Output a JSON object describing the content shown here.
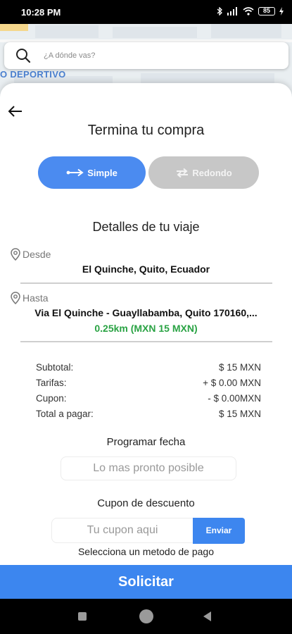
{
  "status_bar": {
    "time": "10:28 PM",
    "battery": "85",
    "icons": [
      "bluetooth-icon",
      "signal-icon",
      "wifi-icon",
      "battery-icon"
    ]
  },
  "map": {
    "label": "O DEPORTIVO"
  },
  "search": {
    "placeholder": "¿A dónde vas?"
  },
  "checkout": {
    "title": "Termina tu compra",
    "trip_types": [
      {
        "label": "Simple",
        "icon": "one-way-arrow-icon",
        "active": true
      },
      {
        "label": "Redondo",
        "icon": "round-trip-icon",
        "active": false
      }
    ],
    "details_title": "Detalles de tu viaje",
    "from_label": "Desde",
    "from_value": "El Quinche, Quito, Ecuador",
    "to_label": "Hasta",
    "to_value": "Via El Quinche - Guayllabamba, Quito 170160,...",
    "distance": "0.25km (MXN 15 MXN)",
    "summary": [
      {
        "label": "Subtotal:",
        "value": "$ 15 MXN"
      },
      {
        "label": "Tarifas:",
        "value": "+ $ 0.00 MXN"
      },
      {
        "label": "Cupon:",
        "value": "- $ 0.00MXN"
      },
      {
        "label": "Total a pagar:",
        "value": "$ 15 MXN"
      }
    ],
    "schedule_label": "Programar fecha",
    "schedule_value": "Lo mas pronto posible",
    "coupon_label": "Cupon de descuento",
    "coupon_placeholder": "Tu cupon aqui",
    "coupon_button": "Enviar",
    "payment_label": "Selecciona un metodo de pago",
    "submit_label": "Solicitar"
  },
  "colors": {
    "primary": "#3c86ef",
    "inactive": "#c7c7c7",
    "distance": "#2aa344"
  }
}
